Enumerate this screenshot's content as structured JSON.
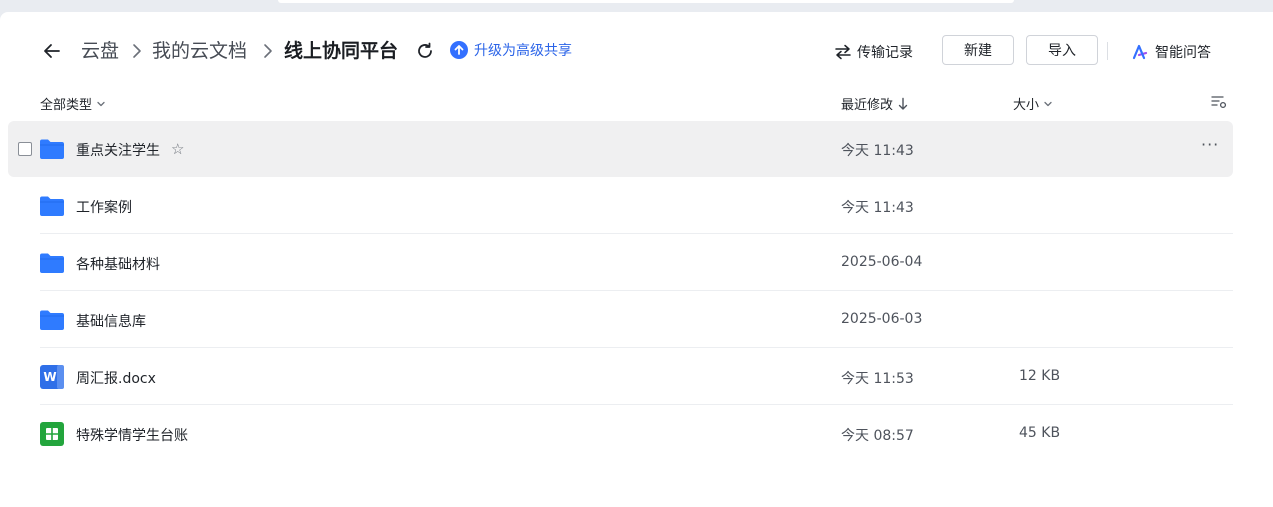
{
  "breadcrumb": {
    "items": [
      "云盘",
      "我的云文档"
    ],
    "current": "线上协同平台"
  },
  "upgrade": {
    "label": "升级为高级共享"
  },
  "toolbar": {
    "transfer_label": "传输记录",
    "new_label": "新建",
    "import_label": "导入",
    "ai_label": "智能问答"
  },
  "columns": {
    "type_filter": "全部类型",
    "modified": "最近修改",
    "size": "大小"
  },
  "files": [
    {
      "name": "重点关注学生",
      "time": "今天 11:43",
      "size": "",
      "kind": "folder"
    },
    {
      "name": "工作案例",
      "time": "今天 11:43",
      "size": "",
      "kind": "folder"
    },
    {
      "name": "各种基础材料",
      "time": "2025-06-04",
      "size": "",
      "kind": "folder"
    },
    {
      "name": "基础信息库",
      "time": "2025-06-03",
      "size": "",
      "kind": "folder"
    },
    {
      "name": "周汇报.docx",
      "time": "今天 11:53",
      "size": "12 KB",
      "kind": "word"
    },
    {
      "name": "特殊学情学生台账",
      "time": "今天 08:57",
      "size": "45 KB",
      "kind": "sheet"
    }
  ],
  "colors": {
    "accent": "#3370ff",
    "folder": "#2f7bff",
    "word": "#2f6fe8",
    "sheet": "#23a53d",
    "hover_row": "#f0f0f1"
  },
  "icons": {
    "back": "arrow-left-icon",
    "chevron": "chevron-right-icon",
    "refresh": "refresh-icon",
    "upgrade": "arrow-up-circle-icon",
    "transfer": "swap-arrows-icon",
    "ai": "ai-spark-icon",
    "sort": "arrow-down-icon",
    "settings": "list-settings-icon",
    "folder": "folder-icon",
    "word": "word-doc-icon",
    "sheet": "spreadsheet-icon",
    "star": "star-icon",
    "more": "more-dots-icon"
  }
}
